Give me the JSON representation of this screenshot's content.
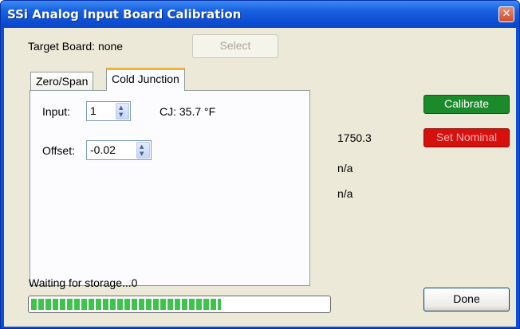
{
  "window": {
    "title": "SSi Analog Input Board Calibration",
    "close_glyph": "✕"
  },
  "target_board": {
    "label": "Target Board: none",
    "select_label": "Select"
  },
  "tabs": [
    {
      "label": "Zero/Span",
      "active": false
    },
    {
      "label": "Cold Junction",
      "active": true
    }
  ],
  "cold_junction": {
    "input_label": "Input:",
    "input_value": "1",
    "cj_readout": "CJ: 35.7 °F",
    "offset_label": "Offset:",
    "offset_value": "-0.02"
  },
  "readouts": [
    "1750.3",
    "n/a",
    "n/a"
  ],
  "buttons": {
    "calibrate": "Calibrate",
    "set_nominal": "Set Nominal",
    "done": "Done"
  },
  "status": {
    "text": "Waiting for storage...0",
    "progress_percent": 64
  },
  "colors": {
    "calibrate_bg": "#1a8a2a",
    "set_nominal_bg": "#d6100d",
    "progress_fill": "#3fc34e",
    "active_tab_accent": "#f4b138"
  }
}
